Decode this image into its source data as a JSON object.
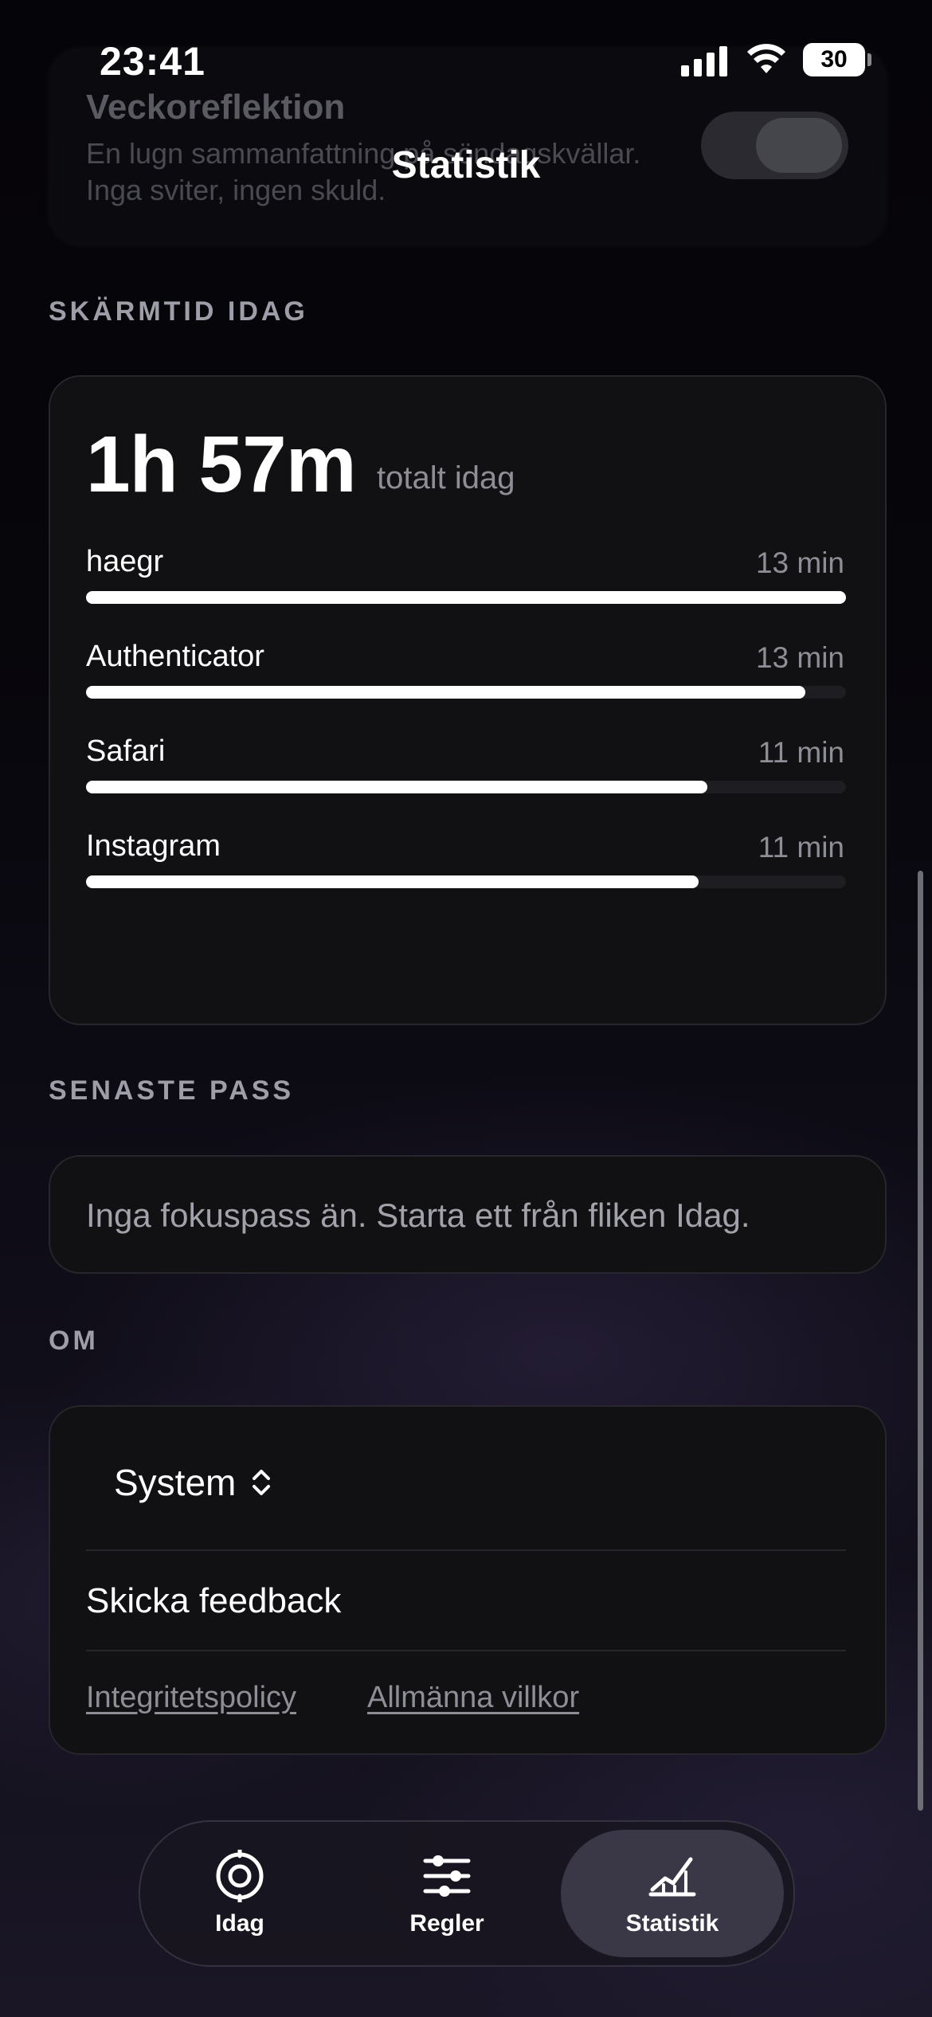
{
  "status_bar": {
    "time": "23:41",
    "battery": "30"
  },
  "background_card": {
    "title": "Veckoreflektion",
    "description": "En lugn sammanfattning på söndagskvällar. Inga sviter, ingen skuld."
  },
  "header": {
    "title": "Statistik"
  },
  "screen_time": {
    "section_label": "SKÄRMTID IDAG",
    "total": "1h 57m",
    "total_suffix": "totalt idag",
    "apps": [
      {
        "name": "haegr",
        "minutes": "13 min",
        "fraction": 1.0
      },
      {
        "name": "Authenticator",
        "minutes": "13 min",
        "fraction": 0.947
      },
      {
        "name": "Safari",
        "minutes": "11 min",
        "fraction": 0.818
      },
      {
        "name": "Instagram",
        "minutes": "11 min",
        "fraction": 0.806
      }
    ]
  },
  "recent_sessions": {
    "section_label": "SENASTE PASS",
    "empty_message": "Inga fokuspass än. Starta ett från fliken Idag."
  },
  "about": {
    "section_label": "OM",
    "appearance_value": "System",
    "feedback_label": "Skicka feedback",
    "privacy_link": "Integritetspolicy",
    "terms_link": "Allmänna villkor"
  },
  "tab_bar": {
    "tabs": [
      {
        "label": "Idag",
        "icon": "target-icon",
        "active": false
      },
      {
        "label": "Regler",
        "icon": "sliders-icon",
        "active": false
      },
      {
        "label": "Statistik",
        "icon": "chart-icon",
        "active": true
      }
    ]
  }
}
